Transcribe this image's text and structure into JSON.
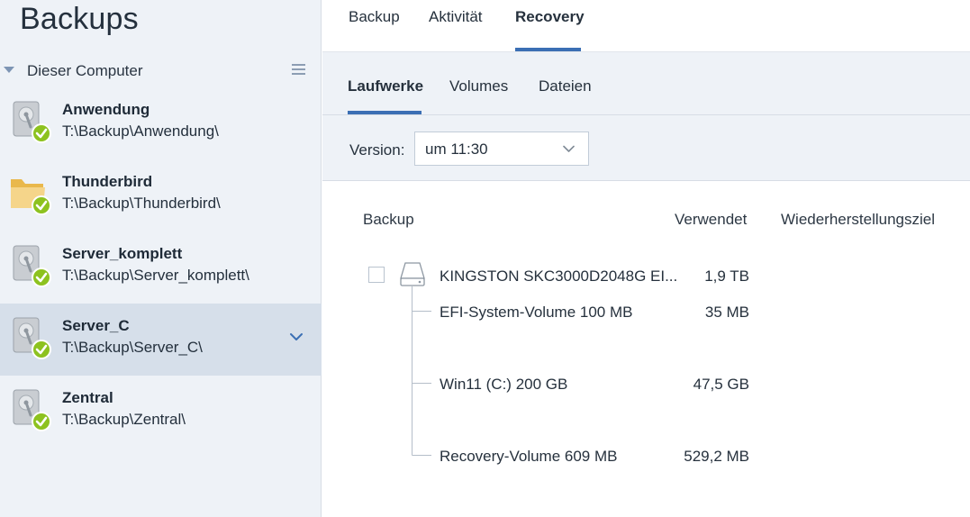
{
  "sidebar": {
    "title": "Backups",
    "group_label": "Dieser Computer",
    "group_menu_icon": "hamburger-icon",
    "items": [
      {
        "name": "Anwendung",
        "path": "T:\\Backup\\Anwendung\\",
        "icon": "disk-icon",
        "status": "ok"
      },
      {
        "name": "Thunderbird",
        "path": "T:\\Backup\\Thunderbird\\",
        "icon": "folder-icon",
        "status": "ok"
      },
      {
        "name": "Server_komplett",
        "path": "T:\\Backup\\Server_komplett\\",
        "icon": "disk-icon",
        "status": "ok"
      },
      {
        "name": "Server_C",
        "path": "T:\\Backup\\Server_C\\",
        "icon": "disk-icon",
        "status": "ok",
        "selected": true
      },
      {
        "name": "Zentral",
        "path": "T:\\Backup\\Zentral\\",
        "icon": "disk-icon",
        "status": "ok"
      }
    ]
  },
  "top_tabs": [
    {
      "label": "Backup"
    },
    {
      "label": "Aktivität"
    },
    {
      "label": "Recovery",
      "active": true
    }
  ],
  "sub_tabs": [
    {
      "label": "Laufwerke",
      "active": true
    },
    {
      "label": "Volumes"
    },
    {
      "label": "Dateien"
    }
  ],
  "version": {
    "label": "Version:",
    "value": "um 11:30"
  },
  "table": {
    "headers": {
      "backup": "Backup",
      "used": "Verwendet",
      "target": "Wiederherstellungsziel"
    },
    "drive": {
      "name": "KINGSTON SKC3000D2048G EI...",
      "used": "1,9 TB",
      "checked": false
    },
    "volumes": [
      {
        "name": "EFI-System-Volume 100 MB",
        "used": "35 MB"
      },
      {
        "name": "Win11 (C:) 200 GB",
        "used": "47,5 GB"
      },
      {
        "name": "Recovery-Volume 609 MB",
        "used": "529,2 MB"
      }
    ]
  },
  "colors": {
    "accent": "#3b6fb4",
    "status_ok": "#8dc21f",
    "sidebar_bg": "#eef2f7",
    "selected_bg": "#d6dfea"
  }
}
